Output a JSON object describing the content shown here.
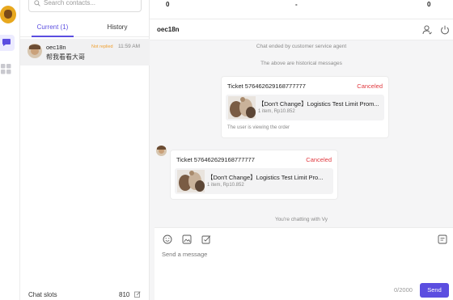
{
  "search": {
    "placeholder": "Search contacts..."
  },
  "tabs": [
    {
      "label": "Current (1)"
    },
    {
      "label": "History"
    }
  ],
  "contact": {
    "name": "oec18n",
    "badge": "Not replied",
    "time": "11:59 AM",
    "last_message": "帮我看看大哥"
  },
  "chat_slots": {
    "label": "Chat slots",
    "value": "810"
  },
  "stats": [
    {
      "value": "0"
    },
    {
      "value": "-"
    },
    {
      "value": "0"
    }
  ],
  "chat": {
    "title": "oec18n",
    "ended_notice": "Chat ended by customer service agent",
    "history_notice": "The above are historical messages",
    "chatting_notice": "You're chatting with Vy"
  },
  "tickets": [
    {
      "title": "Ticket 576462629168777777",
      "status": "Canceled",
      "product_name": "【Don't Change】Logistics Test Limit Prom...",
      "product_meta": "1 item, Rp10.852",
      "footer": "The user is viewing the order"
    },
    {
      "title": "Ticket 576462629168777777",
      "status": "Canceled",
      "product_name": "【Don't Change】Logistics Test Limit Pro...",
      "product_meta": "1 item, Rp10.852"
    }
  ],
  "composer": {
    "placeholder": "Send a message",
    "counter": "0/2000",
    "send_label": "Send"
  },
  "colors": {
    "accent": "#5b4ee0",
    "canceled": "#e0383e",
    "badge": "#f0a030"
  }
}
